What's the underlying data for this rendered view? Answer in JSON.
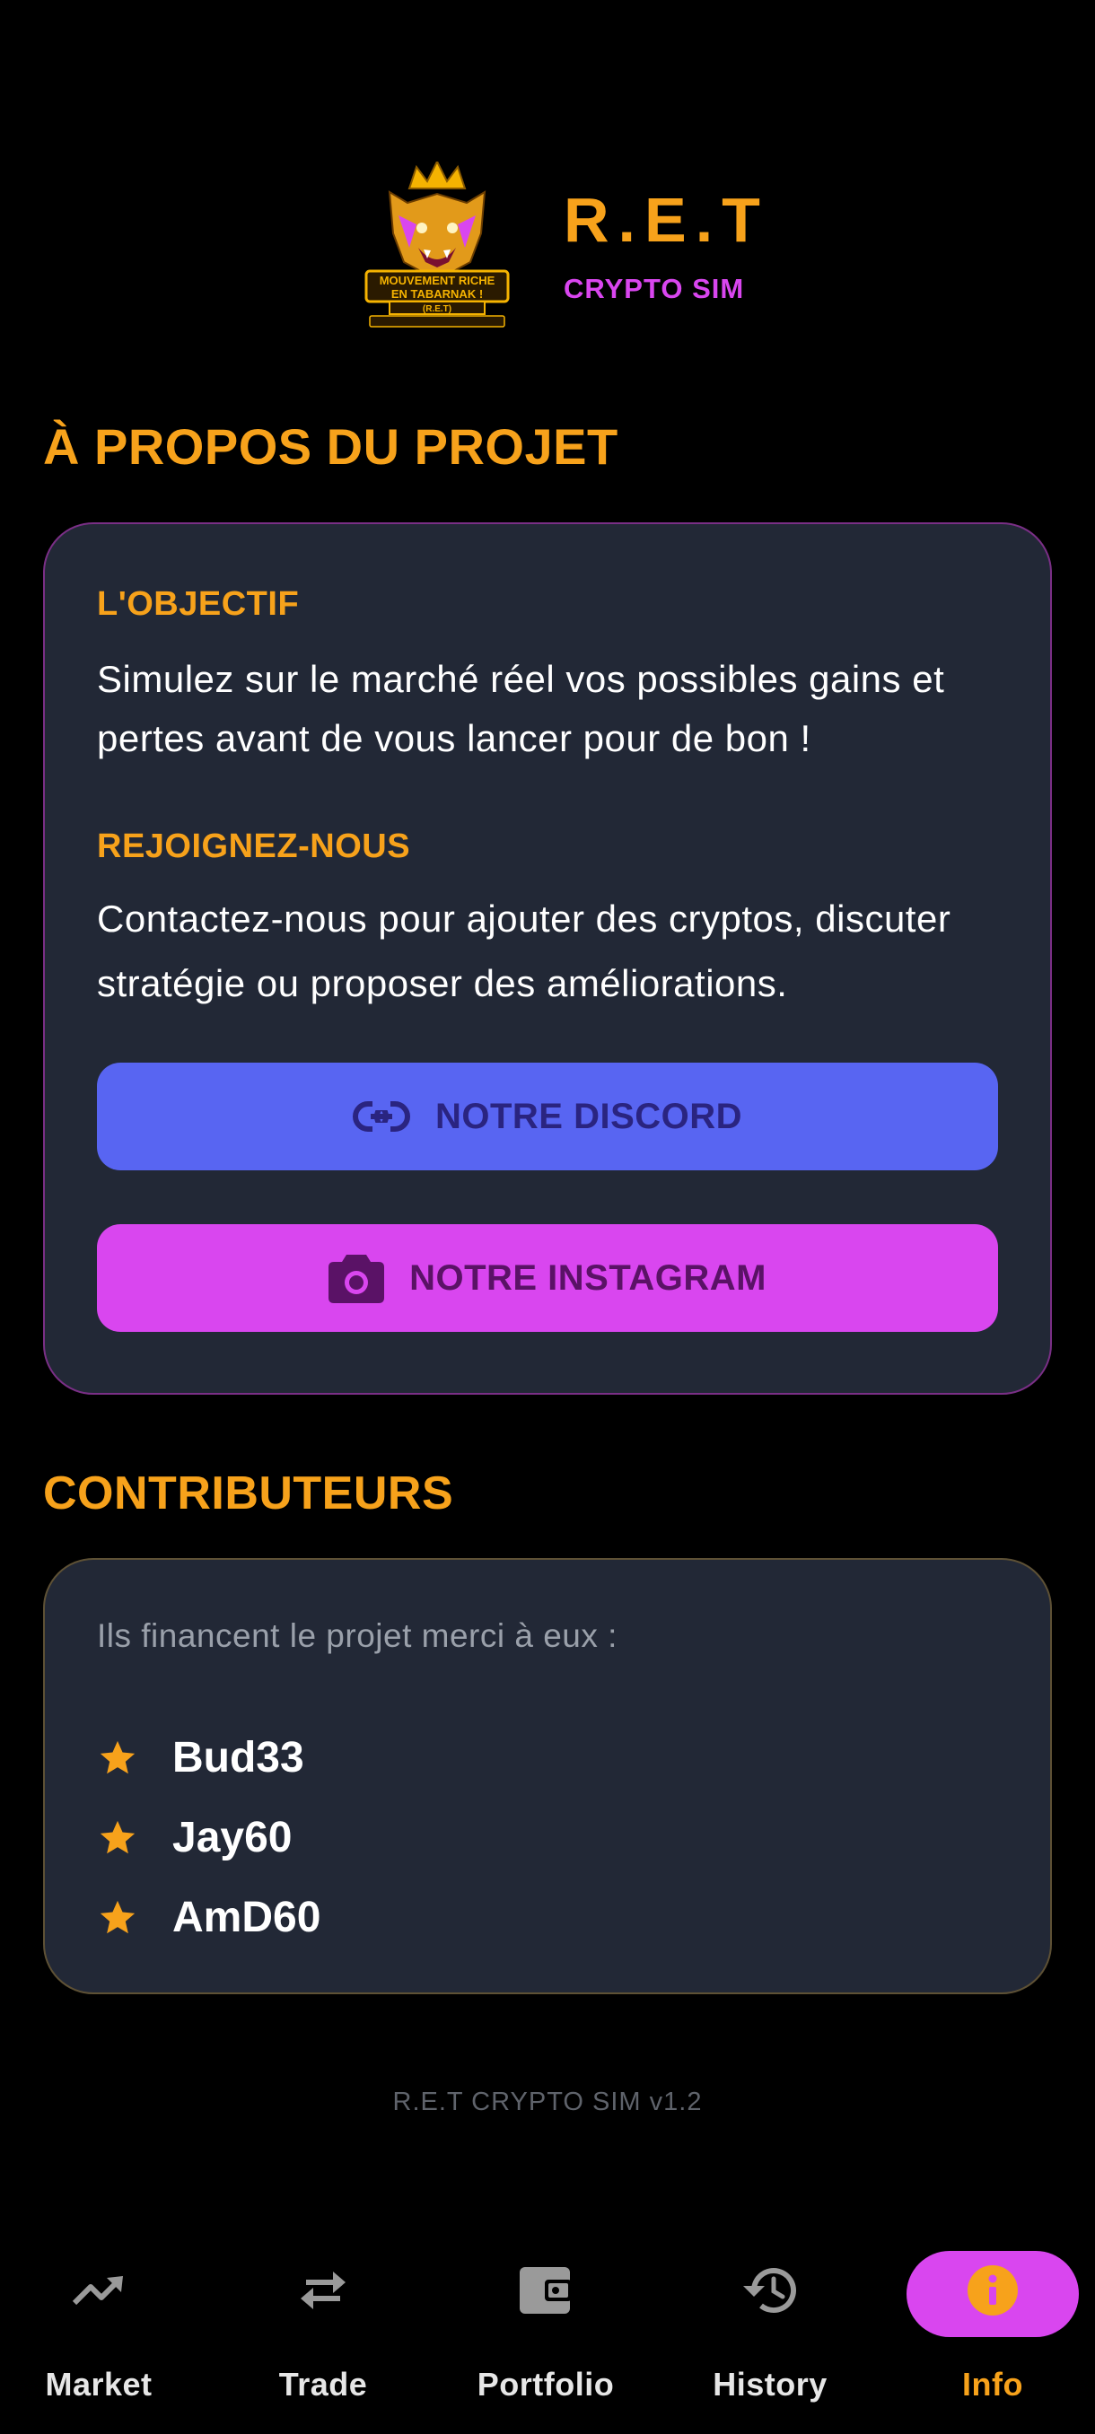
{
  "header": {
    "logo_alt": "Mouvement Riche en Tabarnak ! (R.E.T)",
    "logo_text_1": "MOUVEMENT RICHE",
    "logo_text_2": "EN TABARNAK !",
    "logo_text_3": "(R.E.T)",
    "title": "R.E.T",
    "subtitle": "CRYPTO SIM"
  },
  "about": {
    "section_title": "À PROPOS DU PROJET",
    "objective_label": "L'OBJECTIF",
    "objective_text": "Simulez sur le marché réel vos possibles gains et pertes avant de vous lancer pour de bon !",
    "join_label": "REJOIGNEZ-NOUS",
    "join_text": "Contactez-nous pour ajouter des cryptos, discuter stratégie ou proposer des améliorations.",
    "discord_button": "NOTRE DISCORD",
    "instagram_button": "NOTRE INSTAGRAM"
  },
  "contributors": {
    "section_title": "CONTRIBUTEURS",
    "intro": "Ils financent le projet merci à eux :",
    "names": [
      "Bud33",
      "Jay60",
      "AmD60"
    ]
  },
  "footer": {
    "version": "R.E.T CRYPTO SIM v1.2"
  },
  "nav": {
    "items": [
      {
        "label": "Market",
        "icon": "trending-up-icon"
      },
      {
        "label": "Trade",
        "icon": "swap-arrows-icon"
      },
      {
        "label": "Portfolio",
        "icon": "wallet-icon"
      },
      {
        "label": "History",
        "icon": "history-icon"
      },
      {
        "label": "Info",
        "icon": "info-icon",
        "active": true
      }
    ]
  },
  "colors": {
    "accent_orange": "#f7a21b",
    "accent_magenta": "#d946ef",
    "discord_blue": "#5865f2",
    "card_bg": "#222836",
    "background": "#000000"
  }
}
